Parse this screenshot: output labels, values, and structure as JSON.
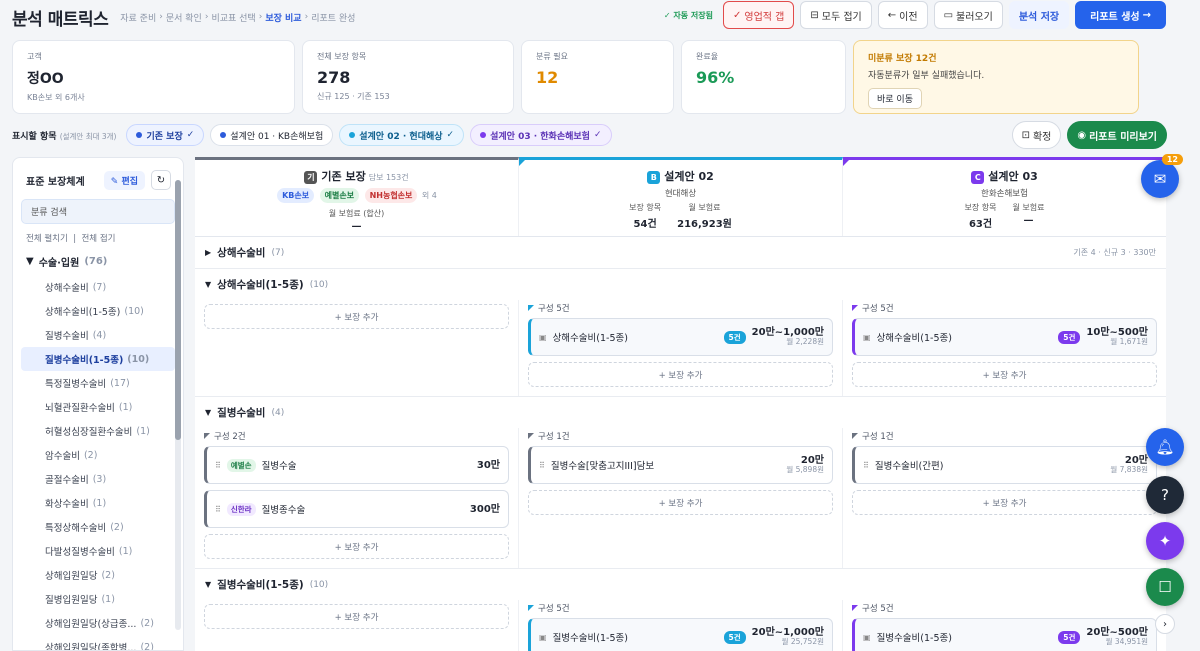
{
  "header": {
    "title": "분석 매트릭스",
    "breadcrumb": [
      "자료 준비",
      "문서 확인",
      "비교표 선택",
      "보장 비교",
      "리포트 완성"
    ],
    "autosave": "자동 저장됨",
    "buttons": {
      "sales_gap": "영업적 갭",
      "collapse_all": "모두 접기",
      "prev": "이전",
      "load": "불러오기",
      "save": "분석 저장",
      "generate": "리포트 생성"
    }
  },
  "stats": {
    "customer": {
      "label": "고객",
      "value": "정OO",
      "sub": "KB손보 외 6개사"
    },
    "total": {
      "label": "전체 보장 항목",
      "value": "278",
      "sub": "신규 125 · 기존 153"
    },
    "needs_class": {
      "label": "분류 필요",
      "value": "12"
    },
    "completion": {
      "label": "완료율",
      "value": "96%"
    },
    "warning": {
      "title": "미분류 보장 12건",
      "desc": "자동분류가 일부 실패했습니다.",
      "button": "바로 이동"
    }
  },
  "filter": {
    "label": "표시할 항목",
    "hint": "(설계안 최대 3개)",
    "chips": [
      "기존 보장",
      "설계안 01 · KB손해보험",
      "설계안 02 · 현대해상",
      "설계안 03 · 한화손해보험"
    ],
    "confirm": "확정",
    "preview": "리포트 미리보기"
  },
  "sidebar": {
    "title": "표준 보장체계",
    "edit": "편집",
    "search": "분류 검색",
    "expand_all": "전체 펼치기",
    "collapse_all": "전체 접기",
    "group": {
      "name": "수술·입원",
      "count": "(76)"
    },
    "items": [
      {
        "name": "상해수술비",
        "count": "(7)"
      },
      {
        "name": "상해수술비(1-5종)",
        "count": "(10)"
      },
      {
        "name": "질병수술비",
        "count": "(4)"
      },
      {
        "name": "질병수술비(1-5종)",
        "count": "(10)"
      },
      {
        "name": "특정질병수술비",
        "count": "(17)"
      },
      {
        "name": "뇌혈관질환수술비",
        "count": "(1)"
      },
      {
        "name": "허혈성심장질환수술비",
        "count": "(1)"
      },
      {
        "name": "암수술비",
        "count": "(2)"
      },
      {
        "name": "골절수술비",
        "count": "(3)"
      },
      {
        "name": "화상수술비",
        "count": "(1)"
      },
      {
        "name": "특정상해수술비",
        "count": "(2)"
      },
      {
        "name": "다발성질병수술비",
        "count": "(1)"
      },
      {
        "name": "상해입원일당",
        "count": "(2)"
      },
      {
        "name": "질병입원일당",
        "count": "(1)"
      },
      {
        "name": "상해입원일당(상급종...",
        "count": "(2)"
      },
      {
        "name": "상해입원일당(종합병...",
        "count": "(2)"
      }
    ]
  },
  "columns": {
    "existing": {
      "tag": "기",
      "name": "기존 보장",
      "dim": "담보 153건",
      "insurers": [
        "KB손보",
        "예별손보",
        "NH농협손보"
      ],
      "more": "외 4",
      "premium_label": "월 보험료 (합산)",
      "premium": "—"
    },
    "plan2": {
      "tag": "B",
      "name": "설계안 02",
      "insurer": "현대해상",
      "count_label": "보장 항목",
      "count": "54건",
      "premium_label": "월 보험료",
      "premium": "216,923원"
    },
    "plan3": {
      "tag": "C",
      "name": "설계안 03",
      "insurer": "한화손해보험",
      "count_label": "보장 항목",
      "count": "63건",
      "premium_label": "월 보험료",
      "premium": "—"
    }
  },
  "sections": {
    "s1": {
      "title": "상해수술비",
      "count": "(7)",
      "meta": "기존 4 · 신규 3 · 330만"
    },
    "s2": {
      "title": "상해수술비(1-5종)",
      "count": "(10)",
      "add": "+ 보장 추가",
      "cfg": "구성 5건",
      "b": {
        "name": "상해수술비(1-5종)",
        "badge": "5건",
        "amount": "20만~1,000만",
        "premium": "월 2,228원"
      },
      "c": {
        "name": "상해수술비(1-5종)",
        "badge": "5건",
        "amount": "10만~500만",
        "premium": "월 1,671원"
      }
    },
    "s3": {
      "title": "질병수술비",
      "count": "(4)",
      "add": "+ 보장 추가",
      "cfg_a": "구성 2건",
      "cfg_b": "구성 1건",
      "cfg_c": "구성 1건",
      "a1": {
        "ins": "예별손",
        "name": "질병수술",
        "amount": "30만"
      },
      "a2": {
        "ins": "신한라",
        "name": "질병종수술",
        "amount": "300만"
      },
      "b": {
        "name": "질병수술[맞춤고지III]담보",
        "amount": "20만",
        "premium": "월 5,898원"
      },
      "c": {
        "name": "질병수술비(간편)",
        "amount": "20만",
        "premium": "월 7,838원"
      }
    },
    "s4": {
      "title": "질병수술비(1-5종)",
      "count": "(10)",
      "add": "+ 보장 추가",
      "cfg": "구성 5건",
      "b": {
        "name": "질병수술비(1-5종)",
        "badge": "5건",
        "amount": "20만~1,000만",
        "premium": "월 25,752원"
      },
      "c": {
        "name": "질병수술비(1-5종)",
        "badge": "5건",
        "amount": "20만~500만",
        "premium": "월 34,951원"
      }
    }
  },
  "fab": {
    "badge": "12"
  },
  "colors": {
    "primary": "#2563eb",
    "plan_b": "#1aa3d9",
    "plan_c": "#7c3aed",
    "green": "#1b8a4c",
    "existing": "#6b7280"
  }
}
